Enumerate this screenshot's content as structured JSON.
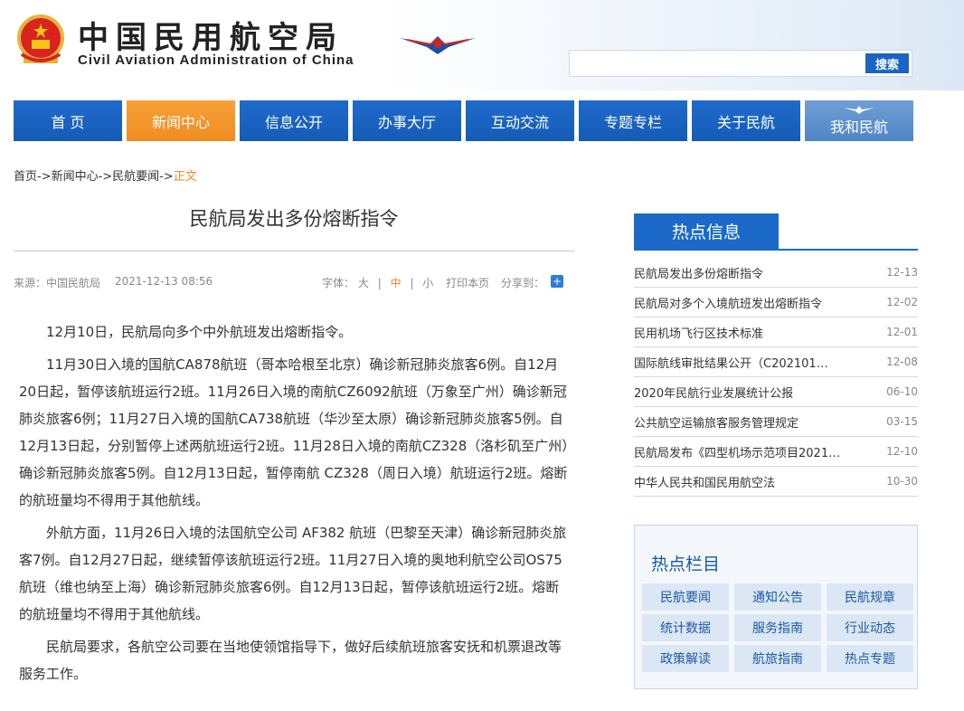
{
  "header": {
    "title_cn": "中国民用航空局",
    "title_en": "Civil Aviation Administration of China",
    "search_placeholder": "",
    "search_button": "搜索"
  },
  "nav": {
    "items": [
      "首 页",
      "新闻中心",
      "信息公开",
      "办事大厅",
      "互动交流",
      "专题专栏",
      "关于民航",
      "我和民航"
    ],
    "active_index": 1
  },
  "breadcrumb": {
    "path": "首页->新闻中心->民航要闻->",
    "current": "正文"
  },
  "article": {
    "title": "民航局发出多份熔断指令",
    "source": "来源：中国民航局",
    "date": "2021-12-13 08:56",
    "font_label": "字体：",
    "font_large": "大",
    "sep1": "|",
    "font_mid": "中",
    "sep2": "|",
    "font_small": "小",
    "print": "打印本页",
    "share": "分享到：",
    "paragraphs": [
      "12月10日，民航局向多个中外航班发出熔断指令。",
      "11月30日入境的国航CA878航班（哥本哈根至北京）确诊新冠肺炎旅客6例。自12月20日起，暂停该航班运行2班。11月26日入境的南航CZ6092航班（万象至广州）确诊新冠肺炎旅客6例；11月27日入境的国航CA738航班（华沙至太原）确诊新冠肺炎旅客5例。自12月13日起，分别暂停上述两航班运行2班。11月28日入境的南航CZ328（洛杉矶至广州）确诊新冠肺炎旅客5例。自12月13日起，暂停南航 CZ328（周日入境）航班运行2班。熔断的航班量均不得用于其他航线。",
      "外航方面，11月26日入境的法国航空公司 AF382 航班（巴黎至天津）确诊新冠肺炎旅客7例。自12月27日起，继续暂停该航班运行2班。11月27日入境的奥地利航空公司OS75 航班（维也纳至上海）确诊新冠肺炎旅客6例。自12月13日起，暂停该航班运行2班。熔断的航班量均不得用于其他航线。",
      "民航局要求，各航空公司要在当地使领馆指导下，做好后续航班旅客安抚和机票退改等服务工作。"
    ]
  },
  "hot_info": {
    "tab": "热点信息",
    "items": [
      {
        "title": "民航局发出多份熔断指令",
        "date": "12-13"
      },
      {
        "title": "民航局对多个入境航班发出熔断指令",
        "date": "12-02"
      },
      {
        "title": "民用机场飞行区技术标准",
        "date": "12-01"
      },
      {
        "title": "国际航线审批结果公开（C202101…",
        "date": "12-08"
      },
      {
        "title": "2020年民航行业发展统计公报",
        "date": "06-10"
      },
      {
        "title": "公共航空运输旅客服务管理规定",
        "date": "03-15"
      },
      {
        "title": "民航局发布《四型机场示范项目2021…",
        "date": "12-10"
      },
      {
        "title": "中华人民共和国民用航空法",
        "date": "10-30"
      }
    ]
  },
  "hot_columns": {
    "title": "热点栏目",
    "items": [
      "民航要闻",
      "通知公告",
      "民航规章",
      "统计数据",
      "服务指南",
      "行业动态",
      "政策解读",
      "航旅指南",
      "热点专题"
    ]
  },
  "colors": {
    "nav_blue": "#1b6ac9",
    "nav_active_orange": "#ef8b1f",
    "accent_blue": "#1a64c6"
  }
}
